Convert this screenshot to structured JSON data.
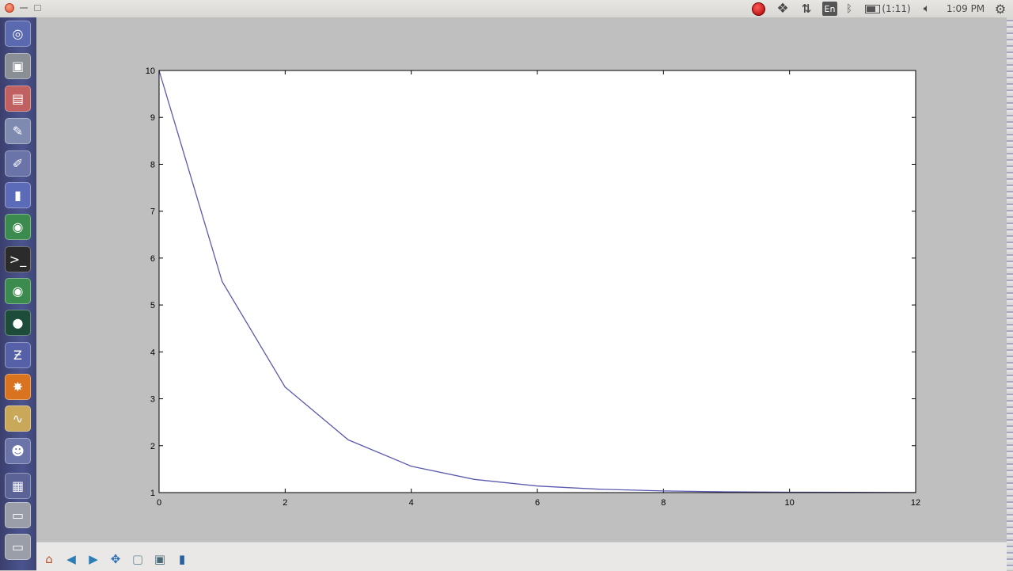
{
  "window": {
    "title": ""
  },
  "topbar": {
    "keyboard_layout": "En",
    "battery_text": "(1:11)",
    "clock": "1:09 PM",
    "icons": [
      "record-icon",
      "dropbox-icon",
      "network-icon",
      "bluetooth-icon",
      "battery-icon",
      "volume-icon",
      "gear-icon"
    ]
  },
  "launcher": {
    "items": [
      {
        "name": "dash-home-icon",
        "color": "#5b6ab0",
        "glyph": "◎"
      },
      {
        "name": "camera-icon",
        "color": "#8a8f96",
        "glyph": "▣"
      },
      {
        "name": "files-icon",
        "color": "#c06060",
        "glyph": "▤"
      },
      {
        "name": "text-editor-icon",
        "color": "#7f8ab0",
        "glyph": "✎"
      },
      {
        "name": "notes-icon",
        "color": "#6a74a8",
        "glyph": "✐"
      },
      {
        "name": "document-icon",
        "color": "#5c6bb8",
        "glyph": "▮"
      },
      {
        "name": "chrome-icon",
        "color": "#3c8b4e",
        "glyph": "◉"
      },
      {
        "name": "terminal-icon",
        "color": "#2b2b2b",
        "glyph": ">_"
      },
      {
        "name": "chrome-alt-icon",
        "color": "#3c8b4e",
        "glyph": "◉"
      },
      {
        "name": "earth-icon",
        "color": "#1d4d3a",
        "glyph": "●"
      },
      {
        "name": "app-z-icon",
        "color": "#5560a8",
        "glyph": "Ƶ"
      },
      {
        "name": "math-icon",
        "color": "#d9731f",
        "glyph": "✸"
      },
      {
        "name": "oscilloscope-icon",
        "color": "#c9a85a",
        "glyph": "∿"
      },
      {
        "name": "penguin-icon",
        "color": "#6a74a8",
        "glyph": "☻"
      },
      {
        "name": "workspace-icon",
        "color": "#5b6296",
        "glyph": "▦"
      },
      {
        "name": "drive-icon",
        "color": "#9a9ea8",
        "glyph": "▭"
      },
      {
        "name": "drive-alt-icon",
        "color": "#9a9ea8",
        "glyph": "▭"
      }
    ]
  },
  "toolbar": {
    "buttons": [
      {
        "name": "home-button",
        "glyph": "⌂",
        "color": "#b5502a"
      },
      {
        "name": "back-button",
        "glyph": "◀",
        "color": "#2a7db5"
      },
      {
        "name": "forward-button",
        "glyph": "▶",
        "color": "#2a7db5"
      },
      {
        "name": "pan-button",
        "glyph": "✥",
        "color": "#2a6db5"
      },
      {
        "name": "zoom-button",
        "glyph": "▢",
        "color": "#6a8a9a"
      },
      {
        "name": "subplots-button",
        "glyph": "▣",
        "color": "#4a6a7a"
      },
      {
        "name": "save-button",
        "glyph": "▮",
        "color": "#2a5f9e"
      }
    ]
  },
  "chart_data": {
    "type": "line",
    "x": [
      0,
      1,
      2,
      3,
      4,
      5,
      6,
      7,
      8,
      9,
      10,
      11,
      12
    ],
    "series": [
      {
        "values": [
          10,
          5.5,
          3.25,
          2.125,
          1.5625,
          1.28125,
          1.140625,
          1.0703125,
          1.03515625,
          1.017578125,
          1.0087890625,
          1.00439453125,
          1.002197265625
        ]
      }
    ],
    "xlim": [
      0,
      12
    ],
    "ylim": [
      1,
      10
    ],
    "xticks": [
      "0",
      "2",
      "4",
      "6",
      "8",
      "10",
      "12"
    ],
    "yticks": [
      "1",
      "2",
      "3",
      "4",
      "5",
      "6",
      "7",
      "8",
      "9",
      "10"
    ],
    "line_color": "#5a5ab0",
    "grid": false,
    "title": "",
    "xlabel": "",
    "ylabel": ""
  }
}
